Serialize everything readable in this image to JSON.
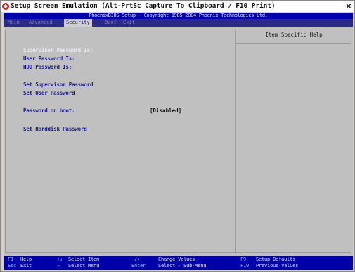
{
  "window": {
    "title": "Setup Screen Emulation (Alt-PrtSc Capture To Clipboard / F10 Print)",
    "close_label": "×"
  },
  "bios": {
    "header": "PhoenixBIOS Setup - Copyright 1985-2004 Phoenix Technologies Ltd.",
    "tabs": [
      "Main",
      "Advanced",
      "Security",
      "Boot",
      "Exit"
    ],
    "active_tab": "Security",
    "fields": {
      "supervisor_password_is": "Supervisor Password Is:",
      "user_password_is": "User Password Is:",
      "hdd_password_is": "HDD Password Is:",
      "set_supervisor_password": "Set Supervisor Password",
      "set_user_password": "Set User Password",
      "password_on_boot": "Password on boot:",
      "password_on_boot_value": "[Disabled]",
      "set_harddisk_password": "Set Harddisk Password"
    },
    "help_title": "Item Specific Help",
    "footer": [
      {
        "key": "F1",
        "desc": "Help"
      },
      {
        "key": "Esc",
        "desc": "Exit"
      },
      {
        "key": "↑↓",
        "desc": "Select Item"
      },
      {
        "key": "↔",
        "desc": "Select Menu"
      },
      {
        "key": "-/+",
        "desc": "Change Values"
      },
      {
        "key": "Enter",
        "desc": "Select ▸ Sub-Menu"
      },
      {
        "key": "F9",
        "desc": "Setup Defaults"
      },
      {
        "key": "F10",
        "desc": "Previous Values"
      }
    ]
  },
  "colors": {
    "bios_blue": "#0000aa",
    "panel_gray": "#c0c0c0",
    "field_blue": "#1a1a8a",
    "key_cyan": "#7fbfe0"
  }
}
